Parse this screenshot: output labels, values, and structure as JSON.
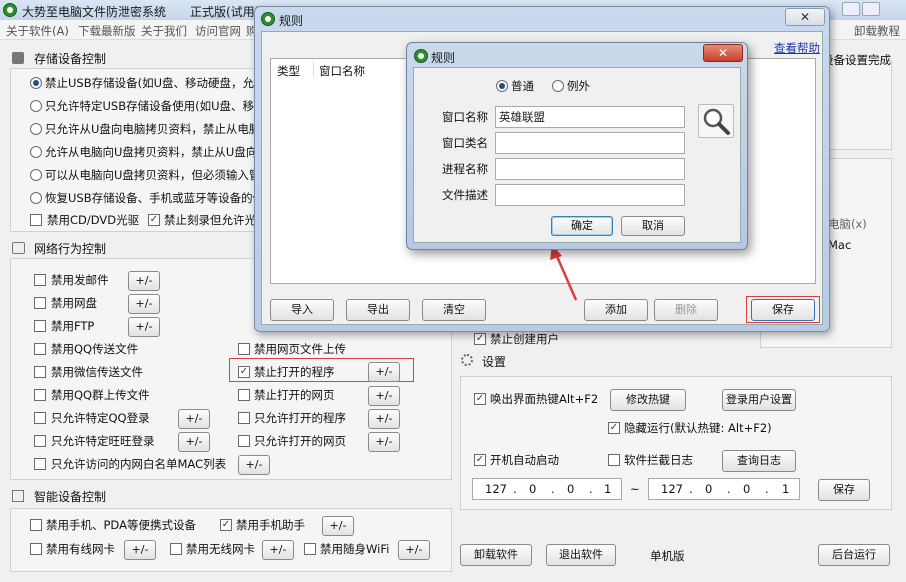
{
  "main": {
    "title": "大势至电脑文件防泄密系统",
    "edition": "正式版(试用)",
    "menu": [
      "关于软件(A)",
      "下载最新版",
      "关于我们",
      "访问官网",
      "购买"
    ],
    "menu_right": "卸载教程",
    "storage": {
      "title": "存储设备控制",
      "radios": [
        "禁止USB存储设备(如U盘、移动硬盘，允许使",
        "只允许特定USB存储设备使用(如U盘、移动硬盘",
        "只允许从U盘向电脑拷贝资料，禁止从电脑向U",
        "允许从电脑向U盘拷贝资料，禁止从U盘向电脑",
        "可以从电脑向U盘拷贝资料，但必须输入管理",
        "恢复USB存储设备、手机或蓝牙等设备的使用("
      ],
      "cd": "禁用CD/DVD光驱",
      "burn": "禁止刻录但允许光驱"
    },
    "network": {
      "title": "网络行为控制",
      "left": [
        "禁用发邮件",
        "禁用网盘",
        "禁用FTP",
        "禁用QQ传送文件",
        "禁用微信传送文件",
        "禁用QQ群上传文件",
        "只允许特定QQ登录",
        "只允许特定旺旺登录",
        "只允许访问的内网白名单MAC列表"
      ],
      "right": [
        "禁用网页文件上传",
        "禁止打开的程序",
        "禁止打开的网页",
        "只允许打开的程序",
        "只允许打开的网页"
      ],
      "pm": "+/-"
    },
    "smart": {
      "title": "智能设备控制",
      "items": [
        "禁用手机、PDA等便携式设备",
        "禁用手机助手",
        "禁用有线网卡",
        "禁用无线网卡",
        "禁用随身WiFi"
      ]
    },
    "right_panel": {
      "device_done": "设备设置完成",
      "computer_x": "电脑(x)",
      "mac": "Mac",
      "new_user": "禁止创建用户"
    },
    "settings": {
      "title": "设置",
      "hotkey": "唤出界面热键Alt+F2",
      "modify_hotkey": "修改热键",
      "login_settings": "登录用户设置",
      "hidden": "隐藏运行(默认热键: Alt+F2)",
      "autostart": "开机自动启动",
      "intercept_log": "软件拦截日志",
      "query_log": "查询日志",
      "ip1": [
        "127",
        "0",
        "0",
        "1"
      ],
      "ip2": [
        "127",
        "0",
        "0",
        "1"
      ],
      "tilde": "~",
      "save": "保存"
    },
    "bottom": {
      "uninstall": "卸载软件",
      "exit": "退出软件",
      "version": "单机版",
      "background": "后台运行"
    }
  },
  "rules_win": {
    "title": "规则",
    "help": "查看帮助",
    "cols": [
      "类型",
      "窗口名称"
    ],
    "buttons": {
      "import": "导入",
      "export": "导出",
      "clear": "清空",
      "add": "添加",
      "delete": "删除",
      "save": "保存"
    }
  },
  "dialog": {
    "title": "规则",
    "mode": [
      "普通",
      "例外"
    ],
    "fields": [
      {
        "label": "窗口名称",
        "value": "英雄联盟"
      },
      {
        "label": "窗口类名",
        "value": ""
      },
      {
        "label": "进程名称",
        "value": ""
      },
      {
        "label": "文件描述",
        "value": ""
      }
    ],
    "ok": "确定",
    "cancel": "取消"
  }
}
